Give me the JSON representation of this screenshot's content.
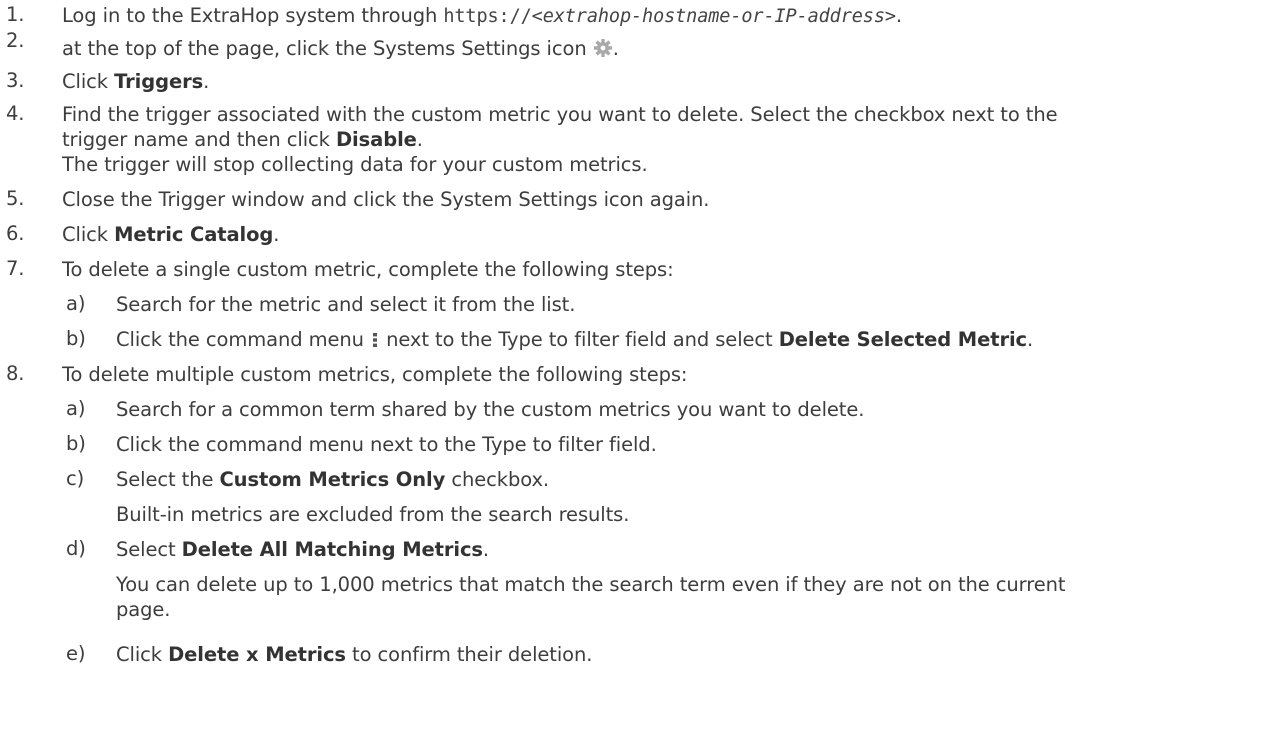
{
  "steps": [
    {
      "num": "1.",
      "pre": "Log in to the ExtraHop system through ",
      "code_pre": "https://<",
      "code_var": "extrahop-hostname-or-IP-address",
      "code_post": ">",
      "post": "."
    },
    {
      "num": "2.",
      "pre": "at the top of the page, click the Systems Settings icon ",
      "icon": "gear-icon",
      "post": "."
    },
    {
      "num": "3.",
      "pre": "Click ",
      "bold": "Triggers",
      "post": "."
    },
    {
      "num": "4.",
      "line1": "Find the trigger associated with the custom metric you want to delete. Select the checkbox next to the",
      "line2_pre": "trigger name and then click ",
      "bold": "Disable",
      "line2_post": ".",
      "result": "The trigger will stop collecting data for your custom metrics."
    },
    {
      "num": "5.",
      "text": "Close the Trigger window and click the System Settings icon again."
    },
    {
      "num": "6.",
      "pre": "Click ",
      "bold": "Metric Catalog",
      "post": "."
    },
    {
      "num": "7.",
      "text": "To delete a single custom metric, complete the following steps:",
      "substeps": [
        {
          "num": "a)",
          "text": "Search for the metric and select it from the list."
        },
        {
          "num": "b)",
          "pre": "Click the command menu ",
          "icon": "kebab-menu-icon",
          "mid": " next to the Type to filter field and select ",
          "bold": "Delete Selected Metric",
          "post": "."
        }
      ]
    },
    {
      "num": "8.",
      "text": "To delete multiple custom metrics, complete the following steps:",
      "substeps": [
        {
          "num": "a)",
          "text": "Search for a common term shared by the custom metrics you want to delete."
        },
        {
          "num": "b)",
          "text": "Click the command menu next to the Type to filter field."
        },
        {
          "num": "c)",
          "pre": "Select the ",
          "bold": "Custom Metrics Only",
          "post": " checkbox.",
          "result": "Built-in metrics are excluded from the search results."
        },
        {
          "num": "d)",
          "pre": "Select ",
          "bold": "Delete All Matching Metrics",
          "post": ".",
          "result_line1": "You can delete up to 1,000 metrics that match the search term even if they are not on the current",
          "result_line2": "page."
        },
        {
          "num": "e)",
          "pre": "Click ",
          "bold": "Delete x Metrics",
          "post": " to confirm their deletion."
        }
      ]
    }
  ]
}
